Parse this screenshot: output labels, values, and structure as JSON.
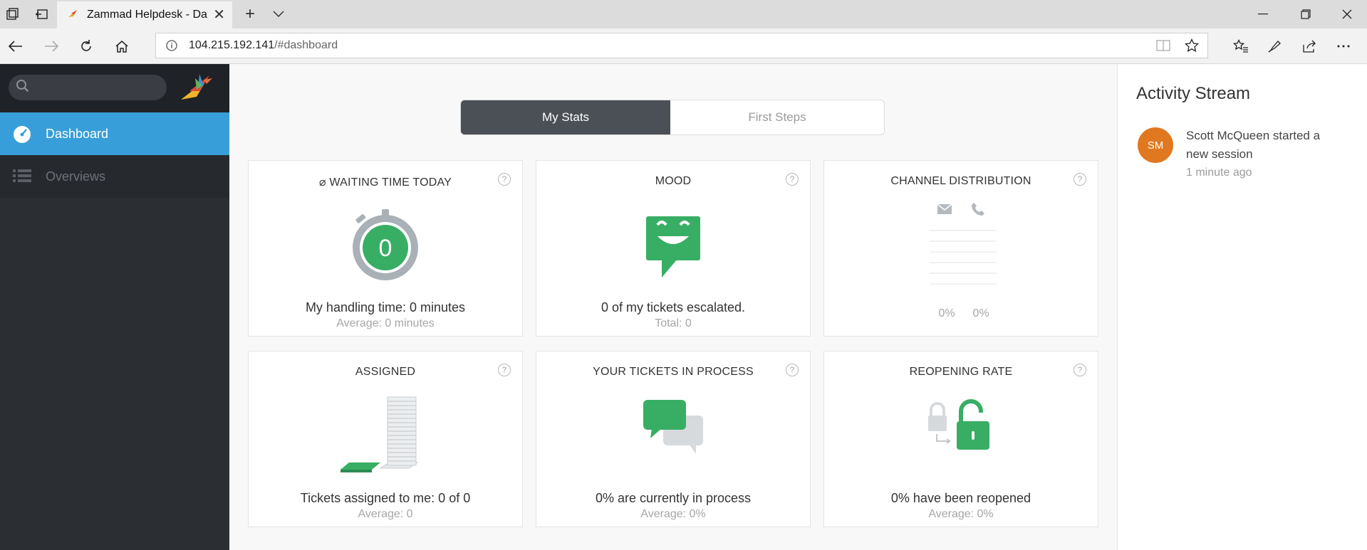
{
  "browser": {
    "tab_title": "Zammad Helpdesk - Da",
    "url_host": "104.215.192.141",
    "url_path": "/#dashboard"
  },
  "sidebar": {
    "items": [
      {
        "label": "Dashboard",
        "icon": "dashboard-icon",
        "active": true
      },
      {
        "label": "Overviews",
        "icon": "list-icon",
        "active": false
      }
    ]
  },
  "tabs": {
    "my_stats": "My Stats",
    "first_steps": "First Steps"
  },
  "cards": {
    "waiting": {
      "title": "⌀ WAITING TIME TODAY",
      "badge": "0",
      "main": "My handling time: 0 minutes",
      "sub": "Average: 0 minutes"
    },
    "mood": {
      "title": "MOOD",
      "main": "0 of my tickets escalated.",
      "sub": "Total: 0"
    },
    "channel": {
      "title": "CHANNEL DISTRIBUTION",
      "email_pct": "0%",
      "phone_pct": "0%"
    },
    "assigned": {
      "title": "ASSIGNED",
      "main": "Tickets assigned to me: 0 of 0",
      "sub": "Average: 0"
    },
    "in_process": {
      "title": "YOUR TICKETS IN PROCESS",
      "main": "0% are currently in process",
      "sub": "Average: 0%"
    },
    "reopening": {
      "title": "REOPENING RATE",
      "main": "0% have been reopened",
      "sub": "Average: 0%"
    }
  },
  "help_glyph": "?",
  "activity": {
    "title": "Activity Stream",
    "items": [
      {
        "initials": "SM",
        "text": "Scott McQueen started a new session",
        "time": "1 minute ago"
      }
    ]
  },
  "colors": {
    "accent_blue": "#389ed9",
    "sidebar_bg": "#2b2e33",
    "green": "#38ae64",
    "avatar_orange": "#e0781f"
  }
}
